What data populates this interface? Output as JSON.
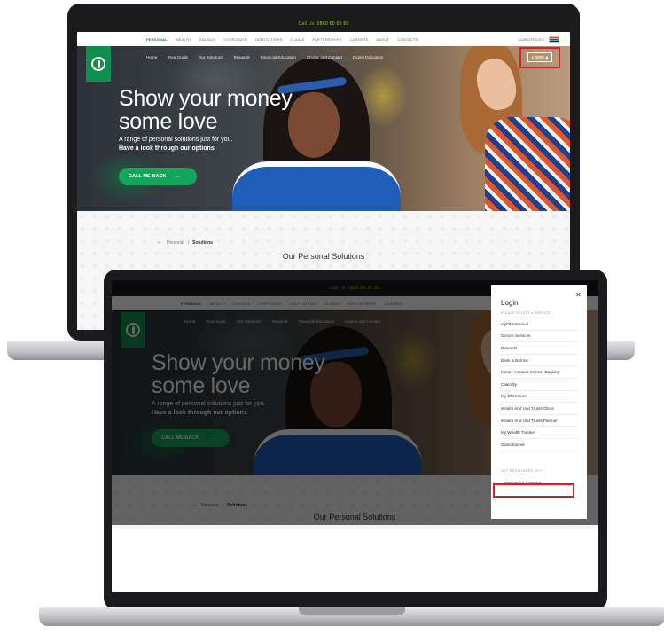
{
  "website": {
    "call_label": "Call Us",
    "call_number": "0860 60 60 60",
    "top_nav": [
      "PERSONAL",
      "WEALTH",
      "SAVINGS",
      "CORPORATE",
      "INSTITUTIONS",
      "CLAIMS",
      "PARTNERSHIPS",
      "CAREERS",
      "ABOUT",
      "CONTACTS"
    ],
    "top_nav_right": "OUR OFFICES",
    "main_nav": [
      "Home",
      "Your Goals",
      "Our Solutions",
      "Rewards",
      "Financial Education",
      "Claims and Contact",
      "Digital Education"
    ],
    "login_button": "LOGIN",
    "headline_line1": "Show your money",
    "headline_line2": "some love",
    "subtext": "A range of personal solutions just for you.",
    "subtext_bold": "Have a look through our options",
    "cta_label": "CALL ME BACK",
    "breadcrumb_parent": "Personal",
    "breadcrumb_sep": "/",
    "breadcrumb_current": "Solutions",
    "section_title": "Our Personal Solutions"
  },
  "login_panel": {
    "title": "Login",
    "close_symbol": "×",
    "select_hint": "PLEASE SELECT A SERVICE",
    "services": [
      "myOMinMutual",
      "Secure Services",
      "Rewards",
      "Bank & Borrow",
      "Money Account Internet Banking",
      "Calendly",
      "My OM Insure",
      "Wealth And Unit Trusts Client",
      "Wealth And Unit Trusts Planner",
      "My Wealth Tracker",
      "Slamchannel"
    ],
    "register_hint": "NOT REGISTERED YET?",
    "register_link": "Register for a service"
  },
  "colors": {
    "brand_green": "#0f8f4d",
    "cta_green": "#13a55a",
    "highlight_red": "#e11c24",
    "topbar": "#1b1b1b"
  },
  "icons": [
    "lock-icon",
    "arrow-right-icon",
    "arrow-left-icon",
    "close-icon",
    "flag-icon",
    "old-mutual-logo"
  ]
}
